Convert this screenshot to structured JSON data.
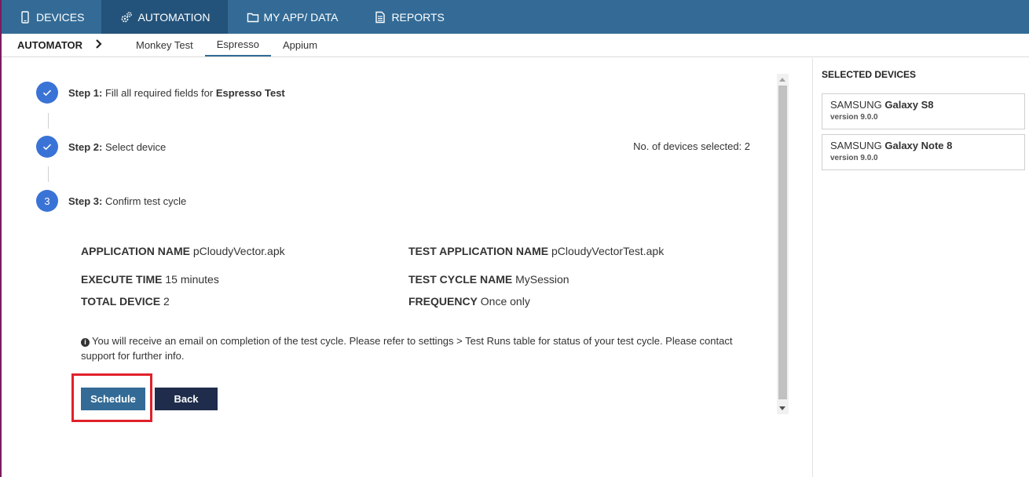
{
  "nav": {
    "items": [
      {
        "label": "DEVICES",
        "icon": "phone-icon"
      },
      {
        "label": "AUTOMATION",
        "icon": "gears-icon"
      },
      {
        "label": "MY APP/ DATA",
        "icon": "folder-icon"
      },
      {
        "label": "REPORTS",
        "icon": "document-icon"
      }
    ],
    "active": "AUTOMATION"
  },
  "subnav": {
    "breadcrumb": "AUTOMATOR",
    "tabs": [
      "Monkey Test",
      "Espresso",
      "Appium"
    ],
    "active_tab": "Espresso"
  },
  "steps": [
    {
      "number": "1",
      "label": "Step 1:",
      "text": " Fill all required fields for ",
      "emph": "Espresso Test",
      "done": true
    },
    {
      "number": "2",
      "label": "Step 2:",
      "text": " Select device",
      "emph": "",
      "done": true
    },
    {
      "number": "3",
      "label": "Step 3:",
      "text": " Confirm test cycle",
      "emph": "",
      "done": false
    }
  ],
  "devices_selected": "No. of devices selected: 2",
  "summary": {
    "app_name_label": "APPLICATION NAME",
    "app_name": "pCloudyVector.apk",
    "test_app_name_label": "TEST APPLICATION NAME",
    "test_app_name": "pCloudyVectorTest.apk",
    "execute_time_label": "EXECUTE TIME",
    "execute_time": "15 minutes",
    "test_cycle_label": "TEST CYCLE NAME",
    "test_cycle": "MySession",
    "total_device_label": "TOTAL DEVICE",
    "total_device": "2",
    "frequency_label": "FREQUENCY",
    "frequency": "Once only"
  },
  "info": {
    "icon": "info-icon",
    "text": "You will receive an email on completion of the test cycle. Please refer to settings > Test Runs table for status of your test cycle. Please contact support for further info."
  },
  "buttons": {
    "schedule": "Schedule",
    "back": "Back"
  },
  "selected_devices": {
    "title": "SELECTED DEVICES",
    "items": [
      {
        "brand": "SAMSUNG",
        "model": "Galaxy S8",
        "version": "version 9.0.0"
      },
      {
        "brand": "SAMSUNG",
        "model": "Galaxy Note 8",
        "version": "version 9.0.0"
      }
    ]
  },
  "colors": {
    "nav_bg": "#336b96",
    "nav_active": "#23537a",
    "step_circle": "#3a73d6",
    "schedule_btn": "#336b96",
    "back_btn": "#1f2c4c",
    "highlight": "#e0212a"
  }
}
